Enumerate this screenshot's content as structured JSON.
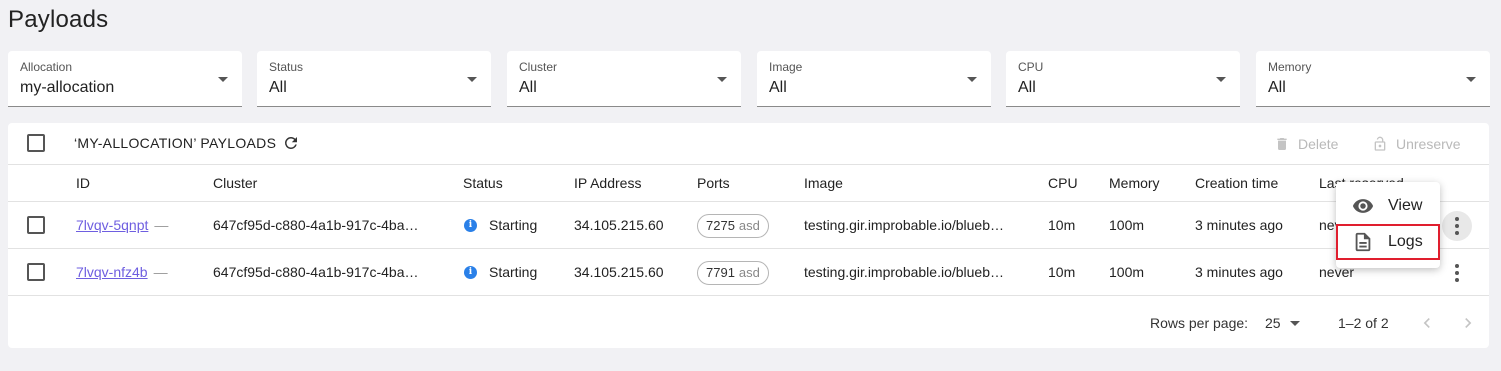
{
  "page_title": "Payloads",
  "filters": [
    {
      "label": "Allocation",
      "value": "my-allocation"
    },
    {
      "label": "Status",
      "value": "All"
    },
    {
      "label": "Cluster",
      "value": "All"
    },
    {
      "label": "Image",
      "value": "All"
    },
    {
      "label": "CPU",
      "value": "All"
    },
    {
      "label": "Memory",
      "value": "All"
    }
  ],
  "toolbar": {
    "title": "‘MY-ALLOCATION’ PAYLOADS",
    "delete_label": "Delete",
    "unreserve_label": "Unreserve"
  },
  "columns": [
    "ID",
    "Cluster",
    "Status",
    "IP Address",
    "Ports",
    "Image",
    "CPU",
    "Memory",
    "Creation time",
    "Last reserved"
  ],
  "rows": [
    {
      "id": "7lvqv-5qnpt",
      "dash": "—",
      "cluster": "647cf95d-c880-4a1b-917c-4ba…",
      "status": "Starting",
      "ip": "34.105.215.60",
      "port": "7275",
      "port_proto": "asd",
      "image": "testing.gir.improbable.io/blueb…",
      "cpu": "10m",
      "memory": "100m",
      "created": "3 minutes ago",
      "last_reserved": "never"
    },
    {
      "id": "7lvqv-nfz4b",
      "dash": "—",
      "cluster": "647cf95d-c880-4a1b-917c-4ba…",
      "status": "Starting",
      "ip": "34.105.215.60",
      "port": "7791",
      "port_proto": "asd",
      "image": "testing.gir.improbable.io/blueb…",
      "cpu": "10m",
      "memory": "100m",
      "created": "3 minutes ago",
      "last_reserved": "never"
    }
  ],
  "pagination": {
    "rows_per_page_label": "Rows per page:",
    "rows_per_page": "25",
    "range": "1–2 of 2"
  },
  "context_menu": {
    "view_label": "View",
    "logs_label": "Logs"
  },
  "colors": {
    "link": "#6e5ee0",
    "status_info": "#2a80e8",
    "highlight": "#e01e2e"
  }
}
